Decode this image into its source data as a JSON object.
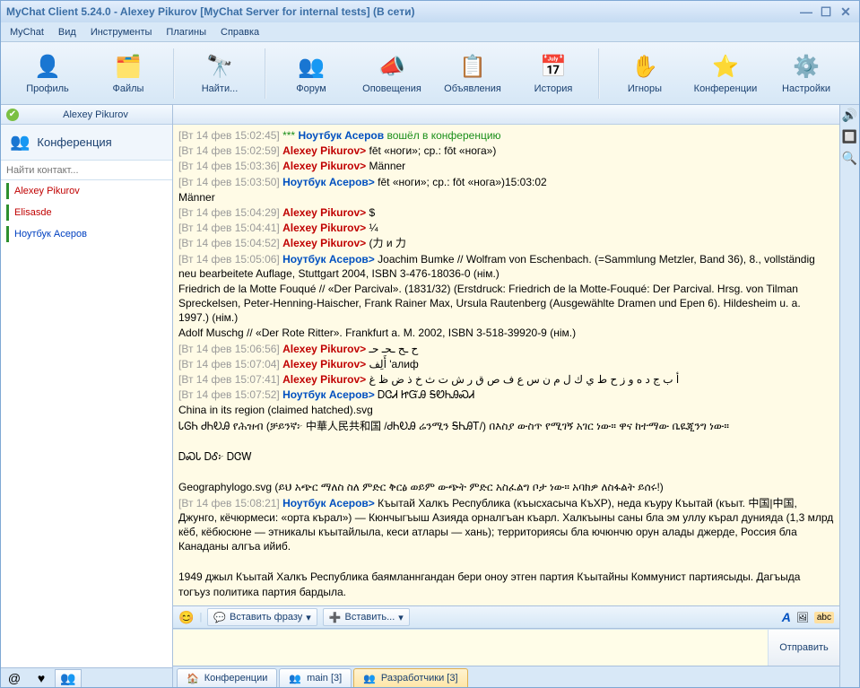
{
  "window": {
    "title": "MyChat Client 5.24.0 - Alexey Pikurov [MyChat Server for internal tests] (В сети)"
  },
  "menu": {
    "items": [
      "MyChat",
      "Вид",
      "Инструменты",
      "Плагины",
      "Справка"
    ]
  },
  "toolbar": {
    "items": [
      {
        "label": "Профиль",
        "icon": "👤"
      },
      {
        "label": "Файлы",
        "icon": "🗂️"
      },
      {
        "label": "Найти...",
        "icon": "🔭"
      },
      {
        "label": "Форум",
        "icon": "👥"
      },
      {
        "label": "Оповещения",
        "icon": "📣"
      },
      {
        "label": "Объявления",
        "icon": "📋"
      },
      {
        "label": "История",
        "icon": "📅"
      },
      {
        "label": "Игноры",
        "icon": "✋"
      },
      {
        "label": "Конференции",
        "icon": "⭐"
      },
      {
        "label": "Настройки",
        "icon": "⚙️"
      }
    ]
  },
  "sidebar": {
    "current_user": "Alexey Pikurov",
    "section_label": "Конференция",
    "search_placeholder": "Найти контакт...",
    "contacts": [
      {
        "name": "Alexey Pikurov",
        "color": "red"
      },
      {
        "name": "Elisasde",
        "color": "red"
      },
      {
        "name": "Ноутбук Асеров",
        "color": "blue"
      }
    ]
  },
  "bottom_left_tabs": {
    "icons": [
      "@",
      "♥",
      "👥"
    ]
  },
  "chat": {
    "lines": [
      {
        "ts": "[Вт 14 фев 15:02:45]",
        "prefix": "*** ",
        "user": "Ноутбук Асеров",
        "uc": "blue",
        "suffix": "",
        "text": " вошёл в конференцию",
        "tclass": "sys-green"
      },
      {
        "ts": "[Вт 14 фев 15:02:59]",
        "user": "Alexey Pikurov",
        "uc": "red",
        "suffix": ">",
        "text": " fēt «ноги»; ср.: fōt «нога»)",
        "tclass": "plain"
      },
      {
        "ts": "[Вт 14 фев 15:03:36]",
        "user": "Alexey Pikurov",
        "uc": "red",
        "suffix": ">",
        "text": " Männer",
        "tclass": "plain"
      },
      {
        "ts": "[Вт 14 фев 15:03:50]",
        "user": "Ноутбук Асеров",
        "uc": "blue",
        "suffix": ">",
        "text": " fēt «ноги»; ср.: fōt «нога»)15:03:02",
        "tclass": "plain"
      },
      {
        "plain": "Männer"
      },
      {
        "ts": "[Вт 14 фев 15:04:29]",
        "user": "Alexey Pikurov",
        "uc": "red",
        "suffix": ">",
        "text": " $",
        "tclass": "plain"
      },
      {
        "ts": "[Вт 14 фев 15:04:41]",
        "user": "Alexey Pikurov",
        "uc": "red",
        "suffix": ">",
        "text": " ¼",
        "tclass": "plain"
      },
      {
        "ts": "[Вт 14 фев 15:04:52]",
        "user": "Alexey Pikurov",
        "uc": "red",
        "suffix": ">",
        "text": " (力 и 力",
        "tclass": "plain"
      },
      {
        "ts": "[Вт 14 фев 15:05:06]",
        "user": "Ноутбук Асеров",
        "uc": "blue",
        "suffix": ">",
        "text": " Joachim Bumke // Wolfram von Eschenbach. (=Sammlung Metzler, Band 36), 8., vollständig neu bearbeitete Auflage, Stuttgart 2004, ISBN 3-476-18036-0 (нім.)",
        "tclass": "plain"
      },
      {
        "plain": "Friedrich de la Motte Fouqué // «Der Parcival». (1831/32) (Erstdruck: Friedrich de la Motte-Fouqué: Der Parcival. Hrsg. von Tilman Spreckelsen, Peter-Henning-Haischer, Frank Rainer Max, Ursula Rautenberg (Ausgewählte Dramen und Epen 6). Hildesheim u. a. 1997.) (нім.)"
      },
      {
        "plain": "Adolf Muschg // «Der Rote Ritter». Frankfurt a. M. 2002, ISBN 3-518-39920-9 (нім.)"
      },
      {
        "ts": "[Вт 14 фев 15:06:56]",
        "user": "Alexey Pikurov",
        "uc": "red",
        "suffix": ">",
        "text": " ح   ـح   ـحـ   حـ",
        "tclass": "plain"
      },
      {
        "ts": "[Вт 14 фев 15:07:04]",
        "user": "Alexey Pikurov",
        "uc": "red",
        "suffix": ">",
        "text": " أَلِف 'алиф",
        "tclass": "plain"
      },
      {
        "ts": "[Вт 14 фев 15:07:41]",
        "user": "Alexey Pikurov",
        "uc": "red",
        "suffix": ">",
        "text": " أ ب ج د ه و ز ح ط ي ك ل م ن س ع ف ص ق ر ش ت ث خ ذ ض ظ غ",
        "tclass": "plain"
      },
      {
        "ts": "[Вт 14 фев 15:07:52]",
        "user": "Ноутбук Асеров",
        "uc": "blue",
        "suffix": ">",
        "text": " ᎠᏣᏗ ᏥᏳᎯ ᎦᏬᏂᎯᏍᏗ",
        "tclass": "plain"
      },
      {
        "plain": "China in its region (claimed hatched).svg"
      },
      {
        "plain": "ᏓᎶᏂ ᏧᏂᎧᎯ የሕዝብ (ቻይንኛ፦ 中華人民共和国 /ᏧᏂᎧᎯ ሬንሚን ᎦᏂᎯᎢ/) በእስያ ውስጥ የሚገኝ አገር ነው። ዋና ከተማው ቤዪጂንግ ነው።"
      },
      {
        "plain": " "
      },
      {
        "plain": "ᎠᏍᏓ ᎠᎴ፦ ᎠᏣᎳ"
      },
      {
        "plain": " "
      },
      {
        "plain": "Geographylogo.svg (ይህ አጭር ማለስ ስለ ምድር ቅርፅ ወይም ውጭት ምድር አስፈልግ ቦታ ነው። አባክዎ ለስፋልት ይሰሩ!)"
      },
      {
        "ts": "[Вт 14 фев 15:08:21]",
        "user": "Ноутбук Асеров",
        "uc": "blue",
        "suffix": ">",
        "text": " Къытай Халкъ Республика (къысхасыча КъХР), неда къуру Къытай (къыт. 中国|中国, Джунго, кёчюрмеси: «орта кърал») — Кюнчыгъыш Азияда орналгъан къарл. Халкъыны саны бла эм уллу кърал дунияда (1,3 млрд кёб, кёбюсюне — этникалы къытайлыла, кеси атлары — хань); территориясы бла ючюнчю орун алады джерде, Россия бла Канаданы алгъа ийиб.",
        "tclass": "plain"
      },
      {
        "plain": " "
      },
      {
        "plain": "1949 джыл Къытай Халкъ Республика баямланнгандан бери оноу этген партия Къытайны Коммунист партиясыды. Дагъыда тогъуз политика партия бардыла."
      }
    ]
  },
  "input_toolbar": {
    "smile": "😊",
    "insert_phrase": "Вставить фразу",
    "insert": "Вставить...",
    "font_icon": "A",
    "emoji_icon": "🖼",
    "spell_icon": "abc"
  },
  "send_button": "Отправить",
  "chat_tabs": {
    "items": [
      {
        "label": "Конференции",
        "icon": "🏠",
        "active": false
      },
      {
        "label": "main [3]",
        "icon": "👥",
        "active": false
      },
      {
        "label": "Разработчики [3]",
        "icon": "👥",
        "active": true
      }
    ]
  },
  "side_icons": [
    "🔊",
    "🔲",
    "🔍"
  ]
}
